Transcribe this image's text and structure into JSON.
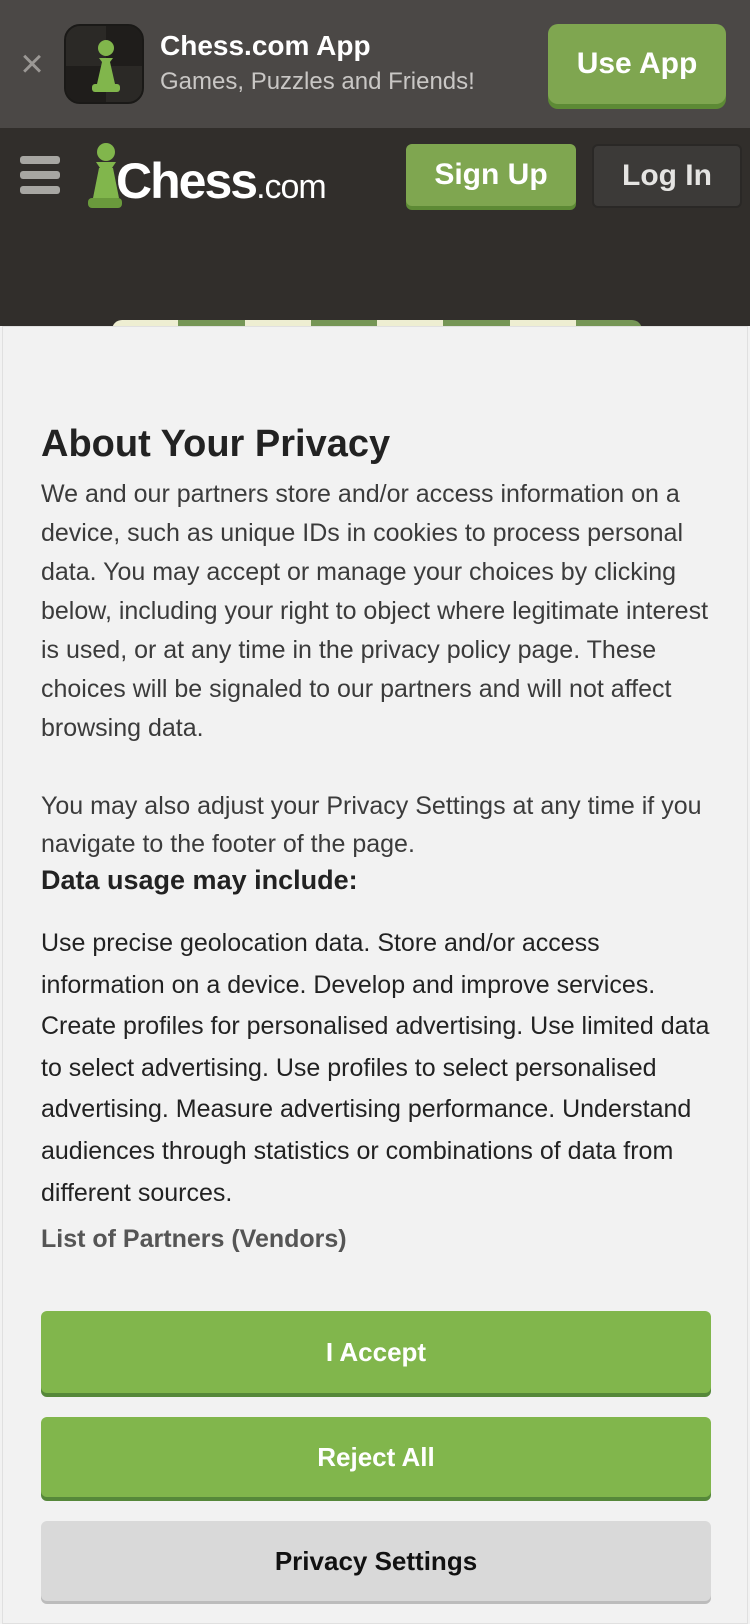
{
  "app_banner": {
    "title": "Chess.com App",
    "subtitle": "Games, Puzzles and Friends!",
    "button": "Use App",
    "close_glyph": "×",
    "icon": "pawn-icon"
  },
  "header": {
    "logo_main": "Chess",
    "logo_suffix": ".com",
    "signup": "Sign Up",
    "login": "Log In",
    "menu_icon": "hamburger-menu-icon"
  },
  "colors": {
    "accent_green": "#81b64c",
    "header_bg": "#312e2b",
    "banner_bg": "#4b4846"
  },
  "privacy": {
    "title": "About Your Privacy",
    "body": "We and our partners store and/or access information on a device, such as unique IDs in cookies to process personal data. You may accept or manage your choices by clicking below, including your right to object where legitimate interest is used, or at any time in the privacy policy page. These choices will be signaled to our partners and will not affect browsing data.",
    "body2": "You may also adjust your Privacy Settings at any time if you navigate to the footer of the page.",
    "usage_heading": "Data usage may include:",
    "usage_body": "Use precise geolocation data. Store and/or access information on a device. Develop and improve services. Create profiles for personalised advertising. Use limited data to select advertising. Use profiles to select personalised advertising. Measure advertising performance. Understand audiences through statistics or combinations of data from different sources.",
    "partners_link": "List of Partners (Vendors)",
    "accept": "I Accept",
    "reject": "Reject All",
    "settings": "Privacy Settings"
  }
}
